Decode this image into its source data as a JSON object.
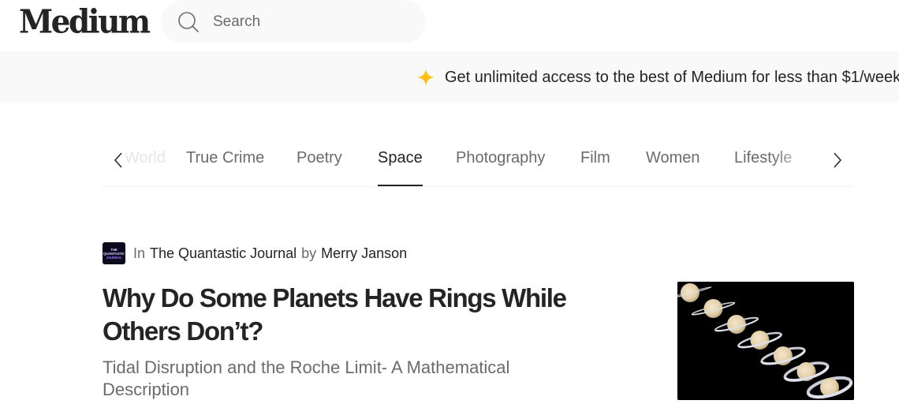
{
  "header": {
    "logo": "Medium",
    "search": {
      "placeholder": "Search",
      "value": ""
    }
  },
  "banner": {
    "icon": "sparkle-icon",
    "accent_color": "#ffc017",
    "text": "Get unlimited access to the best of Medium for less than $1/week."
  },
  "topics": {
    "prev_icon": "chevron-left-icon",
    "next_icon": "chevron-right-icon",
    "items": [
      {
        "label": "World",
        "state": "faded"
      },
      {
        "label": "True Crime",
        "state": "normal"
      },
      {
        "label": "Poetry",
        "state": "normal"
      },
      {
        "label": "Space",
        "state": "active"
      },
      {
        "label": "Photography",
        "state": "normal"
      },
      {
        "label": "Film",
        "state": "normal"
      },
      {
        "label": "Women",
        "state": "normal"
      },
      {
        "label": "Lifestyle",
        "state": "normal"
      }
    ]
  },
  "article": {
    "publication_logo_text": [
      "THE",
      "QUANTASTIC",
      "JOURNAL"
    ],
    "in_label": "In",
    "publication": "The Quantastic Journal",
    "by_label": "by",
    "author": "Merry Janson",
    "title": "Why Do Some Planets Have Rings While Others Don’t?",
    "subtitle": "Tidal Disruption and the Roche Limit- A Mathematical Description",
    "thumbnail_alt": "Sequence of Saturn images showing ring tilt changes"
  }
}
